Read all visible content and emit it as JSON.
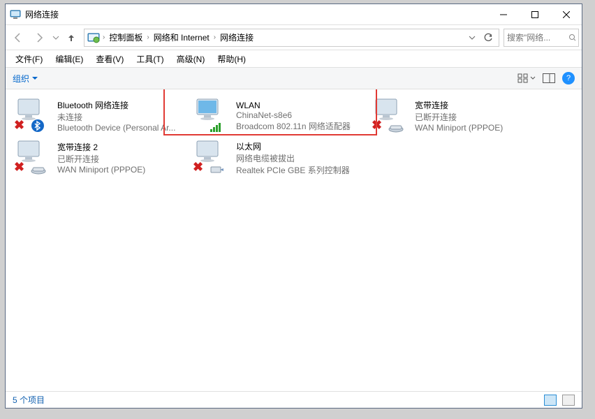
{
  "window_title": "网络连接",
  "breadcrumb": {
    "root": "控制面板",
    "cat": "网络和 Internet",
    "page": "网络连接"
  },
  "search_placeholder": "搜索\"网络...",
  "menus": {
    "file": "文件(F)",
    "edit": "编辑(E)",
    "view": "查看(V)",
    "tools": "工具(T)",
    "advanced": "高级(N)",
    "help": "帮助(H)"
  },
  "toolbar": {
    "organize": "组织"
  },
  "items": [
    {
      "name": "Bluetooth 网络连接",
      "status": "未连接",
      "device": "Bluetooth Device (Personal Ar...",
      "icon_state": "disabled",
      "sub_icon": "bluetooth"
    },
    {
      "name": "WLAN",
      "status": "ChinaNet-s8e6",
      "device": "Broadcom 802.11n 网络适配器",
      "icon_state": "connected",
      "sub_icon": "wifi"
    },
    {
      "name": "宽带连接",
      "status": "已断开连接",
      "device": "WAN Miniport (PPPOE)",
      "icon_state": "disabled",
      "sub_icon": "modem"
    },
    {
      "name": "宽带连接 2",
      "status": "已断开连接",
      "device": "WAN Miniport (PPPOE)",
      "icon_state": "disabled",
      "sub_icon": "modem"
    },
    {
      "name": "以太网",
      "status": "网络电缆被拔出",
      "device": "Realtek PCIe GBE 系列控制器",
      "icon_state": "disabled",
      "sub_icon": "ethernet"
    }
  ],
  "status_text": "5 个项目",
  "highlight_index": 1
}
